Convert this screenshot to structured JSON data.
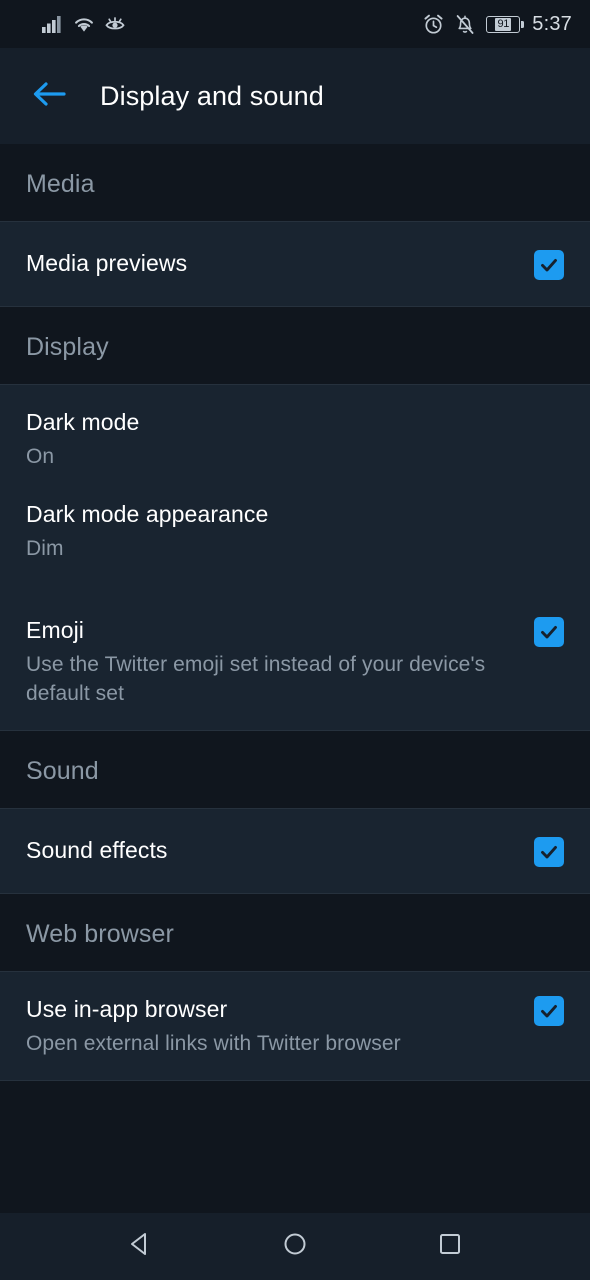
{
  "status_bar": {
    "icons_left": [
      "signal-bars-icon",
      "wifi-icon",
      "eye-comfort-icon"
    ],
    "icons_right": [
      "alarm-clock-icon",
      "notifications-muted-icon"
    ],
    "battery_level": "91",
    "time": "5:37"
  },
  "app_bar": {
    "back_icon": "back-arrow-icon",
    "title": "Display and sound"
  },
  "colors": {
    "accent": "#1D9BF0",
    "background": "#10161E",
    "row_background": "#192430",
    "primary_text": "#FFFFFF",
    "secondary_text": "#8B98A5",
    "divider": "#26313D"
  },
  "sections": [
    {
      "header": "Media",
      "rows": [
        {
          "title": "Media previews",
          "subtitle": "",
          "checkbox": true
        }
      ]
    },
    {
      "header": "Display",
      "rows": [
        {
          "title": "Dark mode",
          "subtitle": "On",
          "checkbox": false
        },
        {
          "title": "Dark mode appearance",
          "subtitle": "Dim",
          "checkbox": false
        },
        {
          "title": "Emoji",
          "subtitle": "Use the Twitter emoji set instead of your device's default set",
          "checkbox": true
        }
      ]
    },
    {
      "header": "Sound",
      "rows": [
        {
          "title": "Sound effects",
          "subtitle": "",
          "checkbox": true
        }
      ]
    },
    {
      "header": "Web browser",
      "rows": [
        {
          "title": "Use in-app browser",
          "subtitle": "Open external links with Twitter browser",
          "checkbox": true
        }
      ]
    }
  ],
  "nav_bar": {
    "back": "nav-back-icon",
    "home": "nav-home-icon",
    "recents": "nav-recents-icon"
  }
}
